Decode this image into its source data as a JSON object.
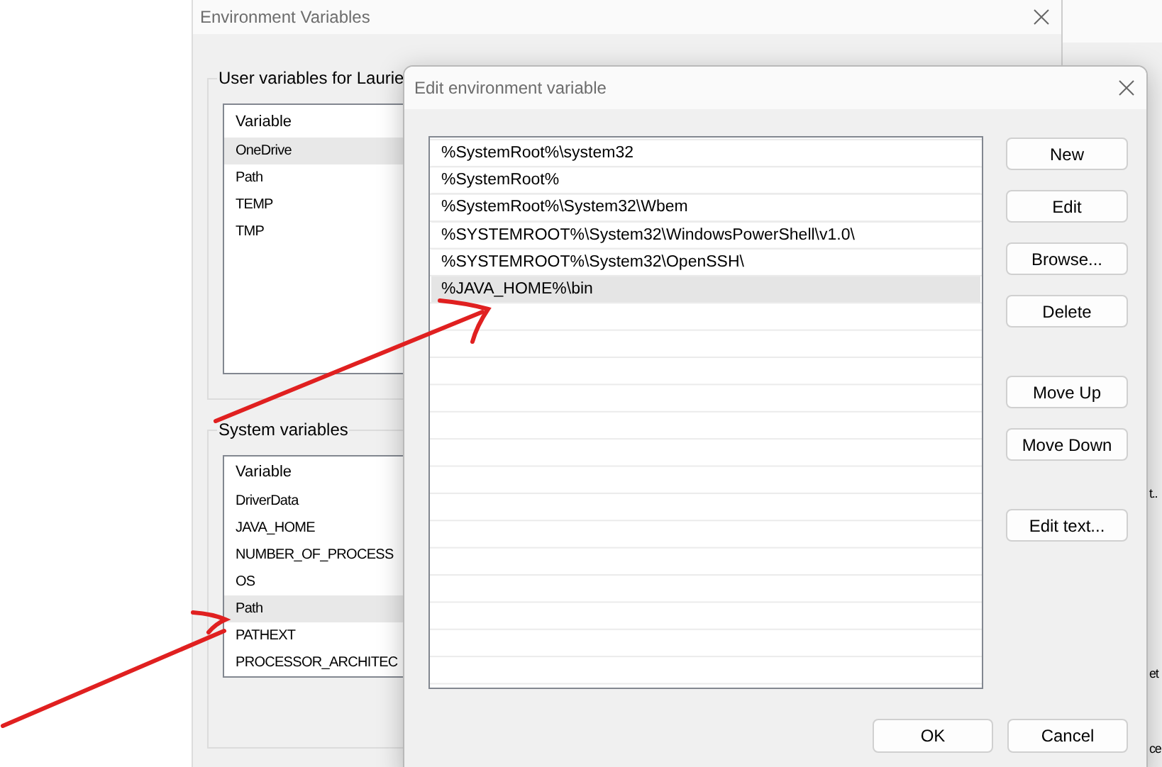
{
  "background_window": {
    "title": "Environment Variables",
    "user_group": {
      "label": "User variables for Laurie",
      "column": "Variable",
      "rows": [
        {
          "name": "OneDrive",
          "selected": true
        },
        {
          "name": "Path",
          "selected": false
        },
        {
          "name": "TEMP",
          "selected": false
        },
        {
          "name": "TMP",
          "selected": false
        }
      ]
    },
    "system_group": {
      "label": "System variables",
      "column": "Variable",
      "rows": [
        {
          "name": "DriverData",
          "selected": false
        },
        {
          "name": "JAVA_HOME",
          "selected": false
        },
        {
          "name": "NUMBER_OF_PROCESS",
          "selected": false
        },
        {
          "name": "OS",
          "selected": false
        },
        {
          "name": "Path",
          "selected": true
        },
        {
          "name": "PATHEXT",
          "selected": false
        },
        {
          "name": "PROCESSOR_ARCHITEC",
          "selected": false
        }
      ]
    }
  },
  "right_window": {
    "fragments": [
      "t..",
      "et",
      "ce"
    ]
  },
  "dialog": {
    "title": "Edit environment variable",
    "entries": [
      {
        "text": "%SystemRoot%\\system32",
        "selected": false
      },
      {
        "text": "%SystemRoot%",
        "selected": false
      },
      {
        "text": "%SystemRoot%\\System32\\Wbem",
        "selected": false
      },
      {
        "text": "%SYSTEMROOT%\\System32\\WindowsPowerShell\\v1.0\\",
        "selected": false
      },
      {
        "text": "%SYSTEMROOT%\\System32\\OpenSSH\\",
        "selected": false
      },
      {
        "text": "%JAVA_HOME%\\bin",
        "selected": true
      }
    ],
    "button_groups": [
      [
        "New",
        "Edit",
        "Browse...",
        "Delete"
      ],
      [
        "Move Up",
        "Move Down"
      ],
      [
        "Edit text..."
      ]
    ],
    "footer_buttons": [
      "OK",
      "Cancel"
    ]
  }
}
